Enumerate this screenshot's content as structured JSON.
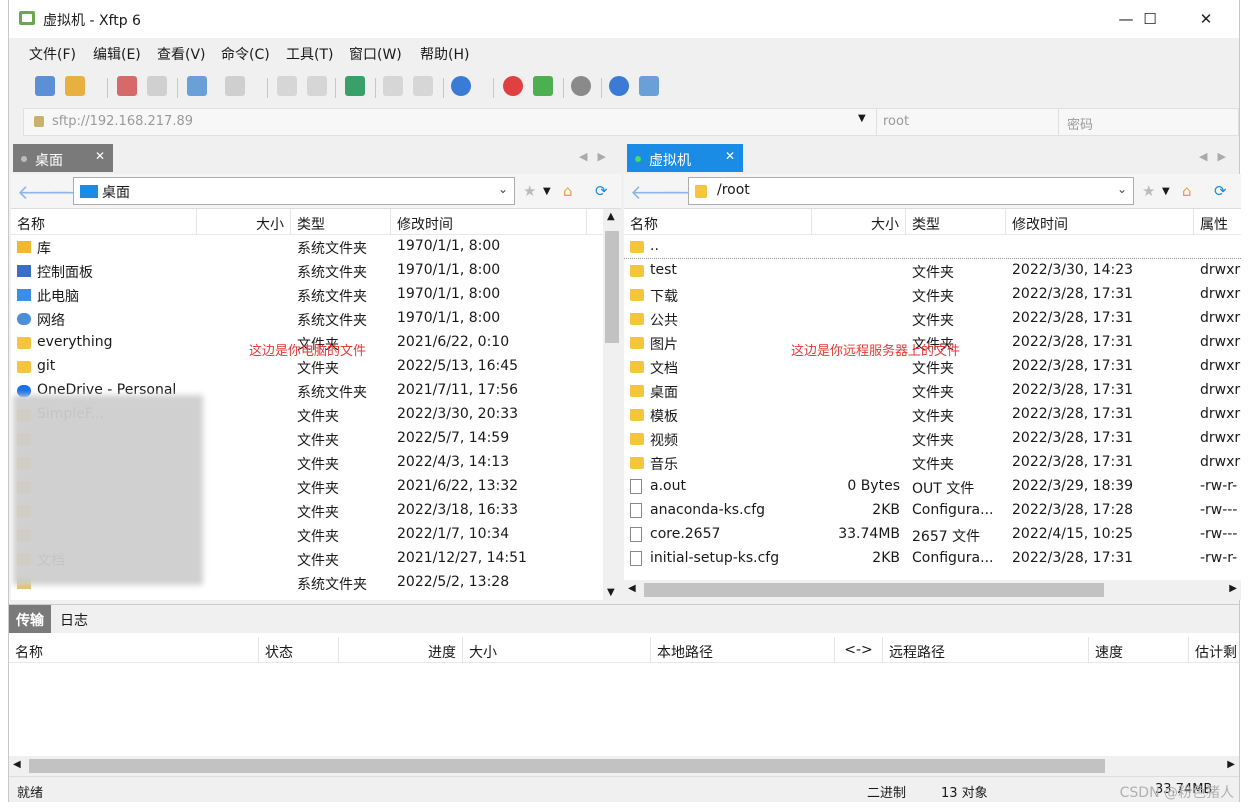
{
  "window": {
    "title": "虚拟机    - Xftp 6",
    "controls": {
      "minimize": "—",
      "maximize": "☐",
      "close": "✕"
    }
  },
  "menu": [
    "文件(F)",
    "编辑(E)",
    "查看(V)",
    "命令(C)",
    "工具(T)",
    "窗口(W)",
    "帮助(H)"
  ],
  "address": {
    "url": "sftp://192.168.217.89",
    "user_placeholder": "root",
    "password_placeholder": "密码"
  },
  "local": {
    "tab_label": "桌面",
    "path": "桌面",
    "columns": [
      "名称",
      "大小",
      "类型",
      "修改时间"
    ],
    "annotation": "这边是你电脑的文件",
    "rows": [
      {
        "name": "库",
        "size": "",
        "type": "系统文件夹",
        "modified": "1970/1/1, 8:00",
        "icon": "library-icon"
      },
      {
        "name": "控制面板",
        "size": "",
        "type": "系统文件夹",
        "modified": "1970/1/1, 8:00",
        "icon": "control-panel-icon"
      },
      {
        "name": "此电脑",
        "size": "",
        "type": "系统文件夹",
        "modified": "1970/1/1, 8:00",
        "icon": "computer-icon"
      },
      {
        "name": "网络",
        "size": "",
        "type": "系统文件夹",
        "modified": "1970/1/1, 8:00",
        "icon": "network-icon"
      },
      {
        "name": "everything",
        "size": "",
        "type": "文件夹",
        "modified": "2021/6/22, 0:10",
        "icon": "folder-icon"
      },
      {
        "name": "git",
        "size": "",
        "type": "文件夹",
        "modified": "2022/5/13, 16:45",
        "icon": "folder-icon"
      },
      {
        "name": "OneDrive - Personal",
        "size": "",
        "type": "系统文件夹",
        "modified": "2021/7/11, 17:56",
        "icon": "cloud-icon"
      },
      {
        "name": "SimpleF...",
        "size": "",
        "type": "文件夹",
        "modified": "2022/3/30, 20:33",
        "icon": "folder-icon"
      },
      {
        "name": "",
        "size": "",
        "type": "文件夹",
        "modified": "2022/5/7, 14:59",
        "icon": "folder-icon"
      },
      {
        "name": "",
        "size": "",
        "type": "文件夹",
        "modified": "2022/4/3, 14:13",
        "icon": "folder-icon"
      },
      {
        "name": "",
        "size": "",
        "type": "文件夹",
        "modified": "2021/6/22, 13:32",
        "icon": "folder-icon"
      },
      {
        "name": "",
        "size": "",
        "type": "文件夹",
        "modified": "2022/3/18, 16:33",
        "icon": "folder-icon"
      },
      {
        "name": "",
        "size": "",
        "type": "文件夹",
        "modified": "2022/1/7, 10:34",
        "icon": "folder-icon"
      },
      {
        "name": "文档",
        "size": "",
        "type": "文件夹",
        "modified": "2021/12/27, 14:51",
        "icon": "folder-icon"
      },
      {
        "name": "",
        "size": "",
        "type": "系统文件夹",
        "modified": "2022/5/2, 13:28",
        "icon": "user-folder-icon"
      }
    ]
  },
  "remote": {
    "tab_label": "虚拟机",
    "path": "/root",
    "columns": [
      "名称",
      "大小",
      "类型",
      "修改时间",
      "属性"
    ],
    "annotation": "这边是你远程服务器上的文件",
    "rows": [
      {
        "name": "..",
        "size": "",
        "type": "",
        "modified": "",
        "attr": "",
        "icon": "folder-icon"
      },
      {
        "name": "test",
        "size": "",
        "type": "文件夹",
        "modified": "2022/3/30, 14:23",
        "attr": "drwxr",
        "icon": "folder-icon"
      },
      {
        "name": "下载",
        "size": "",
        "type": "文件夹",
        "modified": "2022/3/28, 17:31",
        "attr": "drwxr",
        "icon": "folder-icon"
      },
      {
        "name": "公共",
        "size": "",
        "type": "文件夹",
        "modified": "2022/3/28, 17:31",
        "attr": "drwxr",
        "icon": "folder-icon"
      },
      {
        "name": "图片",
        "size": "",
        "type": "文件夹",
        "modified": "2022/3/28, 17:31",
        "attr": "drwxr",
        "icon": "folder-icon"
      },
      {
        "name": "文档",
        "size": "",
        "type": "文件夹",
        "modified": "2022/3/28, 17:31",
        "attr": "drwxr",
        "icon": "folder-icon"
      },
      {
        "name": "桌面",
        "size": "",
        "type": "文件夹",
        "modified": "2022/3/28, 17:31",
        "attr": "drwxr",
        "icon": "folder-icon"
      },
      {
        "name": "模板",
        "size": "",
        "type": "文件夹",
        "modified": "2022/3/28, 17:31",
        "attr": "drwxr",
        "icon": "folder-icon"
      },
      {
        "name": "视频",
        "size": "",
        "type": "文件夹",
        "modified": "2022/3/28, 17:31",
        "attr": "drwxr",
        "icon": "folder-icon"
      },
      {
        "name": "音乐",
        "size": "",
        "type": "文件夹",
        "modified": "2022/3/28, 17:31",
        "attr": "drwxr",
        "icon": "folder-icon"
      },
      {
        "name": "a.out",
        "size": "0 Bytes",
        "type": "OUT 文件",
        "modified": "2022/3/29, 18:39",
        "attr": "-rw-r-",
        "icon": "file-icon"
      },
      {
        "name": "anaconda-ks.cfg",
        "size": "2KB",
        "type": "Configura...",
        "modified": "2022/3/28, 17:28",
        "attr": "-rw---",
        "icon": "config-file-icon"
      },
      {
        "name": "core.2657",
        "size": "33.74MB",
        "type": "2657 文件",
        "modified": "2022/4/15, 10:25",
        "attr": "-rw---",
        "icon": "file-icon"
      },
      {
        "name": "initial-setup-ks.cfg",
        "size": "2KB",
        "type": "Configura...",
        "modified": "2022/3/28, 17:31",
        "attr": "-rw-r-",
        "icon": "config-file-icon"
      }
    ]
  },
  "transfer": {
    "tabs": [
      "传输",
      "日志"
    ],
    "columns": [
      "名称",
      "状态",
      "进度",
      "大小",
      "本地路径",
      "<->",
      "远程路径",
      "速度",
      "估计剩"
    ]
  },
  "status": {
    "left": "就绪",
    "mode": "二进制",
    "count": "13 对象",
    "size": "33.74MB"
  },
  "watermark": "CSDN @粉色猪人",
  "colors": {
    "accent": "#1a8ce6",
    "folder": "#f5c542",
    "annotation": "#e53935",
    "remote_tab": "#1a8ce6",
    "local_tab": "#7a7a7a"
  }
}
